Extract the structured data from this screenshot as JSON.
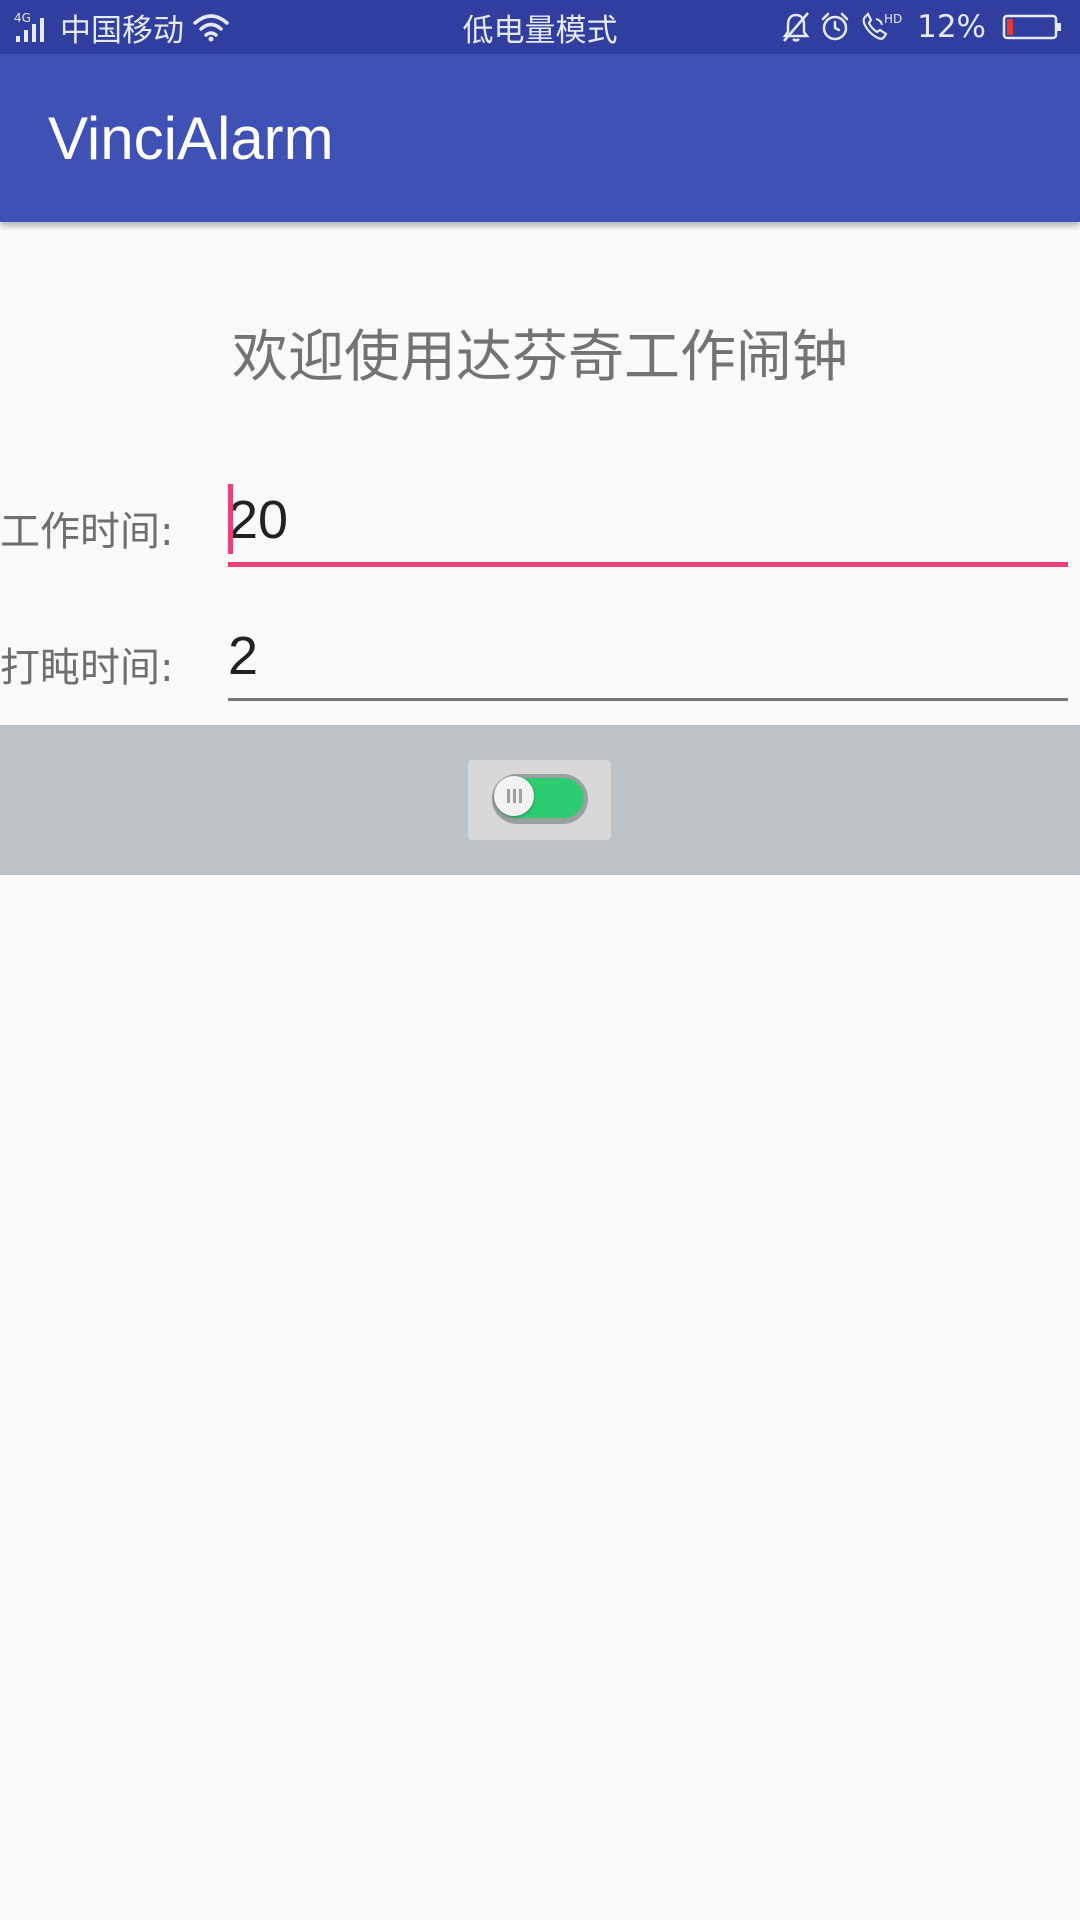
{
  "status_bar": {
    "network_type": "4G",
    "carrier": "中国移动",
    "mode_text": "低电量模式",
    "battery_percent": "12%",
    "icons": [
      "signal-icon",
      "wifi-icon",
      "bell-muted-icon",
      "alarm-clock-icon",
      "hd-call-icon",
      "battery-icon"
    ],
    "colors": {
      "background": "#303f9f",
      "battery_low": "#e53935"
    }
  },
  "app_bar": {
    "title": "VinciAlarm",
    "color": "#3f51b5"
  },
  "main": {
    "welcome_text": "欢迎使用达芬奇工作闹钟",
    "work_time": {
      "label": "工作时间:",
      "value": "20"
    },
    "nap_time": {
      "label": "打盹时间:",
      "value": "2"
    },
    "toggle": {
      "state": "on",
      "on_color": "#2ecc71"
    },
    "accent_color": "#ec407a"
  }
}
